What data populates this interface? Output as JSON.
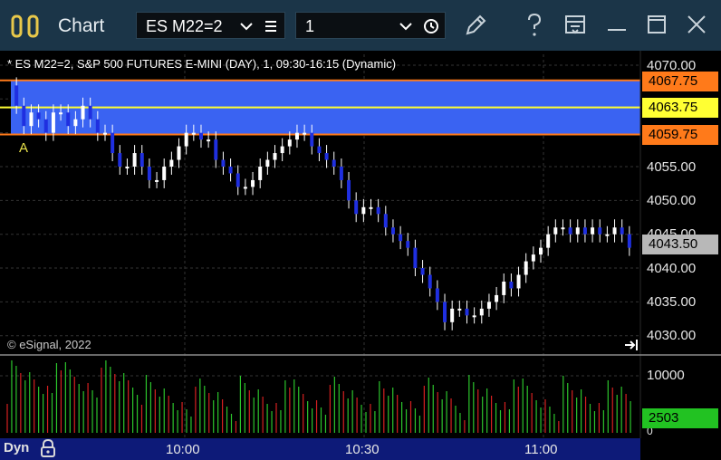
{
  "window": {
    "title": "Chart",
    "symbol_combo": "ES M22=2",
    "interval_combo": "1"
  },
  "chart": {
    "info_line": "* ES M22=2, S&P 500 FUTURES E-MINI (DAY), 1, 09:30-16:15 (Dynamic)",
    "copyright": "© eSignal, 2022",
    "marker_label": "A",
    "mode_label": "Dyn",
    "price_ticks": [
      "4070.00",
      "4055.00",
      "4050.00",
      "4045.00",
      "4040.00",
      "4035.00",
      "4030.00"
    ],
    "volume_ticks": [
      "10000",
      "0"
    ],
    "time_labels": [
      "10:00",
      "10:30",
      "11:00"
    ],
    "upper_band_label": "4067.75",
    "mid_line_label": "4063.75",
    "lower_band_label": "4059.75",
    "last_price_label": "4043.50",
    "volume_label": "2503",
    "colors": {
      "band": "#3a63f2",
      "band_edge": "#ff7a1a",
      "mid_line": "#ffff33",
      "up_candle": "#ffffff",
      "down_candle": "#1f2fe0",
      "volume_up": "#2cc52c",
      "volume_down": "#d62020",
      "title_bar": "#1b3548"
    }
  }
}
